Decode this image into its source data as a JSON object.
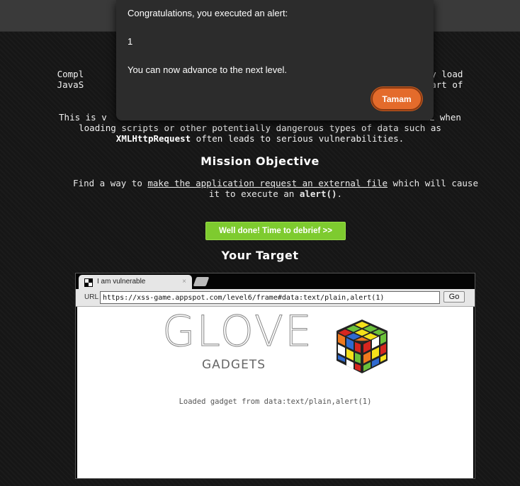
{
  "intro": {
    "line1": "Compl",
    "line1_end": "y load",
    "line2": "JavaS",
    "line2_end": "art of",
    "para2_start": "This is v",
    "para2_end": "URL when",
    "para2_line2": "loading scripts or other potentially dangerous types of data such as",
    "para2_code": "XMLHttpRequest",
    "para2_line3": " often leads to serious vulnerabilities."
  },
  "mission": {
    "title": "Mission Objective",
    "text_pre": "Find a way to ",
    "text_link": "make the application request an external file",
    "text_mid": " which will cause it to execute an ",
    "text_code": "alert()",
    "text_end": "."
  },
  "debrief_button": "Well done! Time to debrief >>",
  "target": {
    "title": "Your Target"
  },
  "browser": {
    "tab_title": "I am vulnerable",
    "tab_close": "×",
    "url_label": "URL",
    "url_value": "https://xss-game.appspot.com/level6/frame#data:text/plain,alert(1)",
    "go_label": "Go"
  },
  "frame": {
    "logo_main": "GLOVE",
    "logo_sub": "GADGETS",
    "loaded_text": "Loaded gadget from data:text/plain,alert(1)"
  },
  "dialog": {
    "title": "Congratulations, you executed an alert:",
    "value": "1",
    "message": "You can now advance to the next level.",
    "ok_label": "Tamam",
    "accent_color": "#e46b2b"
  }
}
